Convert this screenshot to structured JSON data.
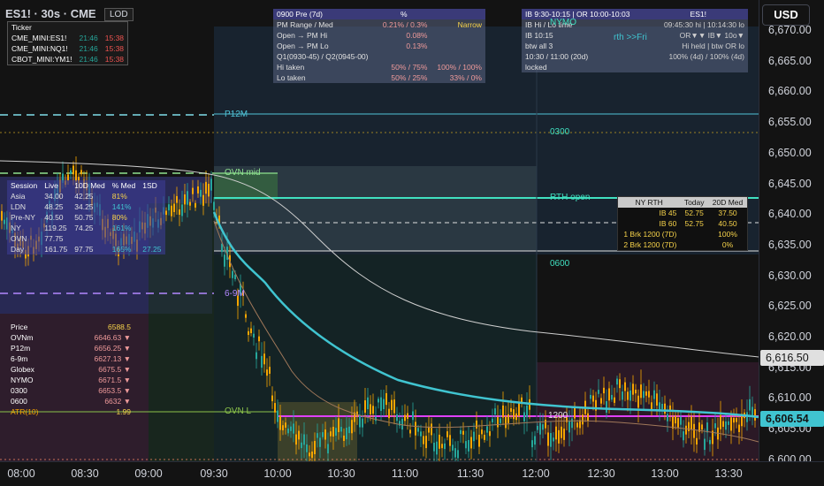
{
  "symbol": {
    "title": "ES1! · 30s · CME",
    "lod_label": "LOD"
  },
  "currency_button": "USD",
  "tickers_table": {
    "header": "Ticker",
    "rows": [
      {
        "name": "CME_MINI:ES1!",
        "t1": "21:46",
        "t2": "15:38"
      },
      {
        "name": "CME_MINI:NQ1!",
        "t1": "21:46",
        "t2": "15:38"
      },
      {
        "name": "CBOT_MINI:YM1!",
        "t1": "21:46",
        "t2": "15:38"
      }
    ]
  },
  "session_table": {
    "headers": [
      "Session",
      "Live",
      "10D Med",
      "% Med",
      "1SD"
    ],
    "rows": [
      [
        "Asia",
        "34.00",
        "42.25",
        "81%",
        ""
      ],
      [
        "LDN",
        "48.25",
        "34.25",
        "141%",
        ""
      ],
      [
        "Pre-NY",
        "40.50",
        "50.75",
        "80%",
        ""
      ],
      [
        "NY",
        "119.25",
        "74.25",
        "161%",
        ""
      ],
      [
        "OVN",
        "77.75",
        "",
        "",
        ""
      ],
      [
        "Day",
        "161.75",
        "97.75",
        "165%",
        "27.25"
      ]
    ]
  },
  "levels_table": {
    "rows": [
      {
        "label": "Price",
        "value": "6588.5",
        "arrow": ""
      },
      {
        "label": "OVNm",
        "value": "6646.63",
        "arrow": "▼"
      },
      {
        "label": "P12m",
        "value": "6656.25",
        "arrow": "▼"
      },
      {
        "label": "6-9m",
        "value": "6627.13",
        "arrow": "▼"
      },
      {
        "label": "Globex",
        "value": "6675.5",
        "arrow": "▼"
      },
      {
        "label": "NYMO",
        "value": "6671.5",
        "arrow": "▼"
      },
      {
        "label": "0300",
        "value": "6653.5",
        "arrow": "▼"
      },
      {
        "label": "0600",
        "value": "6632",
        "arrow": "▼"
      },
      {
        "label": "ATR(10)",
        "value": "1.99",
        "arrow": ""
      }
    ]
  },
  "pre_table": {
    "header": [
      "0900 Pre (7d)",
      "%"
    ],
    "rows": [
      [
        "PM Range / Med",
        "0.21% / 0.3%",
        "Narrow"
      ],
      [
        "Open → PM Hi",
        "0.08%",
        ""
      ],
      [
        "Open → PM Lo",
        "0.13%",
        ""
      ],
      [
        "Q1(0930-45) / Q2(0945-00)",
        "",
        ""
      ],
      [
        "Hi taken",
        "50% / 75%",
        "100% / 100%"
      ],
      [
        "Lo taken",
        "50% / 25%",
        "33% / 0%"
      ]
    ]
  },
  "ib_table": {
    "header": [
      "IB 9:30-10:15  |  OR 10:00-10:03",
      "ES1!"
    ],
    "rows": [
      [
        "IB Hi / Lo time",
        "09:45:30 hi  |  10:14:30 lo"
      ],
      [
        "IB 10:15",
        "OR▼▼  IB▼  10o▼"
      ],
      [
        "btw all 3",
        "Hi held | btw OR lo"
      ],
      [
        "10:30 / 11:00 (20d)",
        "100% (4d) / 100% (4d)"
      ],
      [
        "locked",
        ""
      ]
    ]
  },
  "nyrth_table": {
    "headers": [
      "NY RTH",
      "Today",
      "20D Med"
    ],
    "rows": [
      [
        "IB 45",
        "52.75",
        "37.50"
      ],
      [
        "IB 60",
        "52.75",
        "40.50"
      ],
      [
        "1 Brk 1200 (7D)",
        "",
        "100%"
      ],
      [
        "2 Brk 1200 (7D)",
        "",
        "0%"
      ]
    ]
  },
  "level_labels": {
    "p12m": "P12M",
    "ovn_mid": "OVN mid",
    "rth_open": "RTH open",
    "l0300": "0300",
    "l0600": "0600",
    "ovn_l": "OVN L",
    "nymo": "NYMO",
    "rth_fri": "rth >>Fri",
    "six9m": "6-9M",
    "l1200": "1200"
  },
  "y_axis": [
    "6,670.00",
    "6,665.00",
    "6,660.00",
    "6,655.00",
    "6,650.00",
    "6,645.00",
    "6,640.00",
    "6,635.00",
    "6,630.00",
    "6,625.00",
    "6,620.00",
    "6,615.00",
    "6,610.00",
    "6,605.00",
    "6,600.00"
  ],
  "price_tags": {
    "last": "6,616.50",
    "ema": "6,606.54"
  },
  "x_axis": [
    "08:00",
    "08:30",
    "09:00",
    "09:30",
    "10:00",
    "10:30",
    "11:00",
    "11:30",
    "12:00",
    "12:30",
    "13:00",
    "13:30"
  ],
  "colors": {
    "up": "#26a69a",
    "down": "#ef5350",
    "cyan": "#40c4d0",
    "magenta": "#e040fb",
    "accent_orange": "#f7a600"
  }
}
